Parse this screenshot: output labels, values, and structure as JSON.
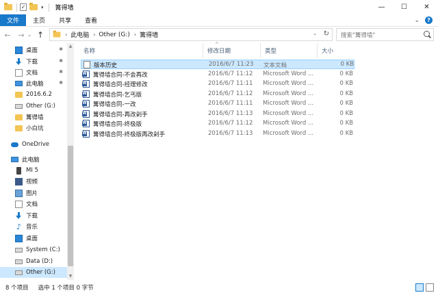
{
  "window": {
    "title": "篝得墙",
    "controls": [
      "—",
      "☐",
      "✕"
    ]
  },
  "ribbon": {
    "tabs": [
      "文件",
      "主页",
      "共享",
      "查看"
    ],
    "expand": "⌄",
    "help": "?"
  },
  "nav": {
    "back": "←",
    "forward": "→",
    "recent": "⌄",
    "up": "↑",
    "breadcrumb": [
      "此电脑",
      "Other (G:)",
      "篝得墙"
    ],
    "search_placeholder": "搜索\"篝得墙\""
  },
  "sidebar": {
    "items": [
      {
        "label": "桌面",
        "icon": "desktop-icon",
        "pinned": true
      },
      {
        "label": "下载",
        "icon": "download-icon",
        "pinned": true
      },
      {
        "label": "文档",
        "icon": "documents-icon",
        "pinned": true
      },
      {
        "label": "此电脑",
        "icon": "pc-icon",
        "pinned": true
      },
      {
        "label": "2016.6.2",
        "icon": "folder-icon",
        "pinned": false
      },
      {
        "label": "Other (G:)",
        "icon": "drive-icon",
        "pinned": false
      },
      {
        "label": "篝得墙",
        "icon": "folder-icon",
        "pinned": false
      },
      {
        "label": "小白坑",
        "icon": "folder-icon",
        "pinned": false
      },
      {
        "label": "OneDrive",
        "icon": "onedrive-icon",
        "pinned": false
      },
      {
        "label": "此电脑",
        "icon": "pc-icon",
        "pinned": false
      },
      {
        "label": "MI 5",
        "icon": "phone-icon",
        "pinned": false
      },
      {
        "label": "视频",
        "icon": "video-icon",
        "pinned": false
      },
      {
        "label": "图片",
        "icon": "pictures-icon",
        "pinned": false
      },
      {
        "label": "文档",
        "icon": "documents-icon",
        "pinned": false
      },
      {
        "label": "下载",
        "icon": "download-icon",
        "pinned": false
      },
      {
        "label": "音乐",
        "icon": "music-icon",
        "pinned": false
      },
      {
        "label": "桌面",
        "icon": "desktop-icon",
        "pinned": false
      },
      {
        "label": "System (C:)",
        "icon": "drive-icon",
        "pinned": false
      },
      {
        "label": "Data (D:)",
        "icon": "drive-icon",
        "pinned": false
      },
      {
        "label": "Other (G:)",
        "icon": "drive-icon",
        "pinned": false,
        "selected": true
      }
    ]
  },
  "files": {
    "columns": [
      "名称",
      "修改日期",
      "类型",
      "大小"
    ],
    "rows": [
      {
        "name": "版本历史",
        "date": "2016/6/7 11:23",
        "type": "文本文档",
        "size": "0 KB",
        "icon": "text-file-icon",
        "selected": true
      },
      {
        "name": "篝得墙合同-不会再改",
        "date": "2016/6/7 11:12",
        "type": "Microsoft Word ...",
        "size": "0 KB",
        "icon": "word-file-icon"
      },
      {
        "name": "篝得墙合同-经理修改",
        "date": "2016/6/7 11:11",
        "type": "Microsoft Word ...",
        "size": "0 KB",
        "icon": "word-file-icon"
      },
      {
        "name": "篝得墙合同-乞丐版",
        "date": "2016/6/7 11:12",
        "type": "Microsoft Word ...",
        "size": "0 KB",
        "icon": "word-file-icon"
      },
      {
        "name": "篝得墙合同-一改",
        "date": "2016/6/7 11:11",
        "type": "Microsoft Word ...",
        "size": "0 KB",
        "icon": "word-file-icon"
      },
      {
        "name": "篝得墙合同-再改剁手",
        "date": "2016/6/7 11:13",
        "type": "Microsoft Word ...",
        "size": "0 KB",
        "icon": "word-file-icon"
      },
      {
        "name": "篝得墙合同-终极版",
        "date": "2016/6/7 11:12",
        "type": "Microsoft Word ...",
        "size": "0 KB",
        "icon": "word-file-icon"
      },
      {
        "name": "篝得墙合同-终极版再改剁手",
        "date": "2016/6/7 11:13",
        "type": "Microsoft Word ...",
        "size": "0 KB",
        "icon": "word-file-icon"
      }
    ]
  },
  "status": {
    "count": "8 个项目",
    "selection": "选中 1 个项目  0 字节"
  },
  "colors": {
    "accent": "#1979ca",
    "selection": "#cce8ff"
  }
}
